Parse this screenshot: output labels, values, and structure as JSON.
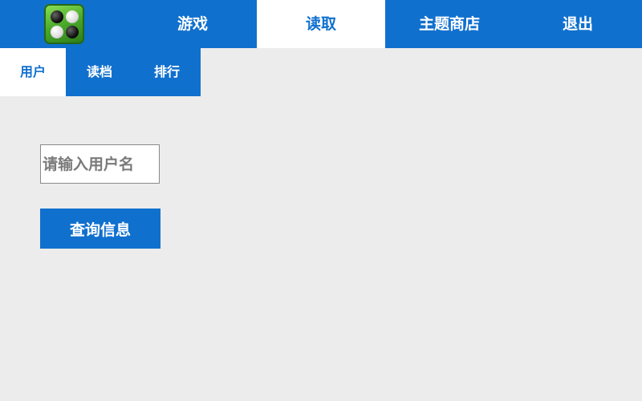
{
  "header": {
    "logo_icon": "othello-game-logo-icon",
    "nav": [
      {
        "label": "游戏",
        "active": false
      },
      {
        "label": "读取",
        "active": true
      },
      {
        "label": "主题商店",
        "active": false
      },
      {
        "label": "退出",
        "active": false
      }
    ]
  },
  "subnav": {
    "items": [
      {
        "label": "用户",
        "active": true
      },
      {
        "label": "读档",
        "active": false
      },
      {
        "label": "排行",
        "active": false
      }
    ]
  },
  "form": {
    "username_placeholder": "请输入用户名",
    "username_value": "",
    "query_button_label": "查询信息"
  },
  "colors": {
    "primary": "#1070ce",
    "background": "#ececec",
    "active_tab_bg": "#ffffff"
  }
}
